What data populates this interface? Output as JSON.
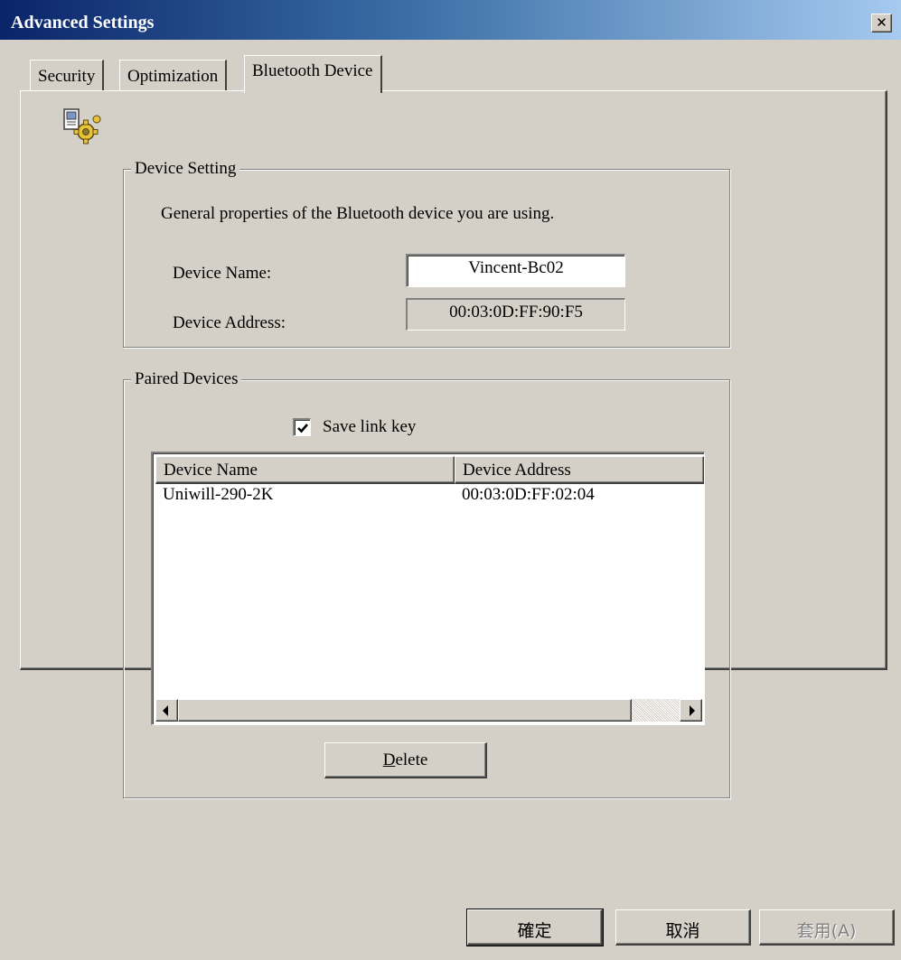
{
  "window": {
    "title": "Advanced Settings",
    "close_glyph": "✕"
  },
  "tabs": [
    {
      "label": "Security",
      "active": false
    },
    {
      "label": "Optimization",
      "active": false
    },
    {
      "label": "Bluetooth Device",
      "active": true
    }
  ],
  "icons": {
    "header": "bluetooth-settings-gear-icon",
    "close": "close-icon"
  },
  "device_setting": {
    "legend": "Device Setting",
    "description": "General properties of the Bluetooth device you are using.",
    "name_label": "Device Name:",
    "name_value": "Vincent-Bc02",
    "address_label": "Device Address:",
    "address_value": "00:03:0D:FF:90:F5"
  },
  "paired_devices": {
    "legend": "Paired Devices",
    "save_link_key": {
      "label": "Save link key",
      "checked": true
    },
    "columns": [
      "Device Name",
      "Device Address"
    ],
    "rows": [
      {
        "name": "Uniwill-290-2K",
        "address": "00:03:0D:FF:02:04"
      }
    ],
    "delete_button": {
      "accel": "D",
      "rest": "elete"
    }
  },
  "footer": {
    "ok": "確定",
    "cancel": "取消",
    "apply": "套用(A)"
  },
  "colors": {
    "face": "#d4d0c8",
    "title_start": "#0a246a",
    "title_end": "#a6caf0",
    "disabled_text": "#808080"
  }
}
